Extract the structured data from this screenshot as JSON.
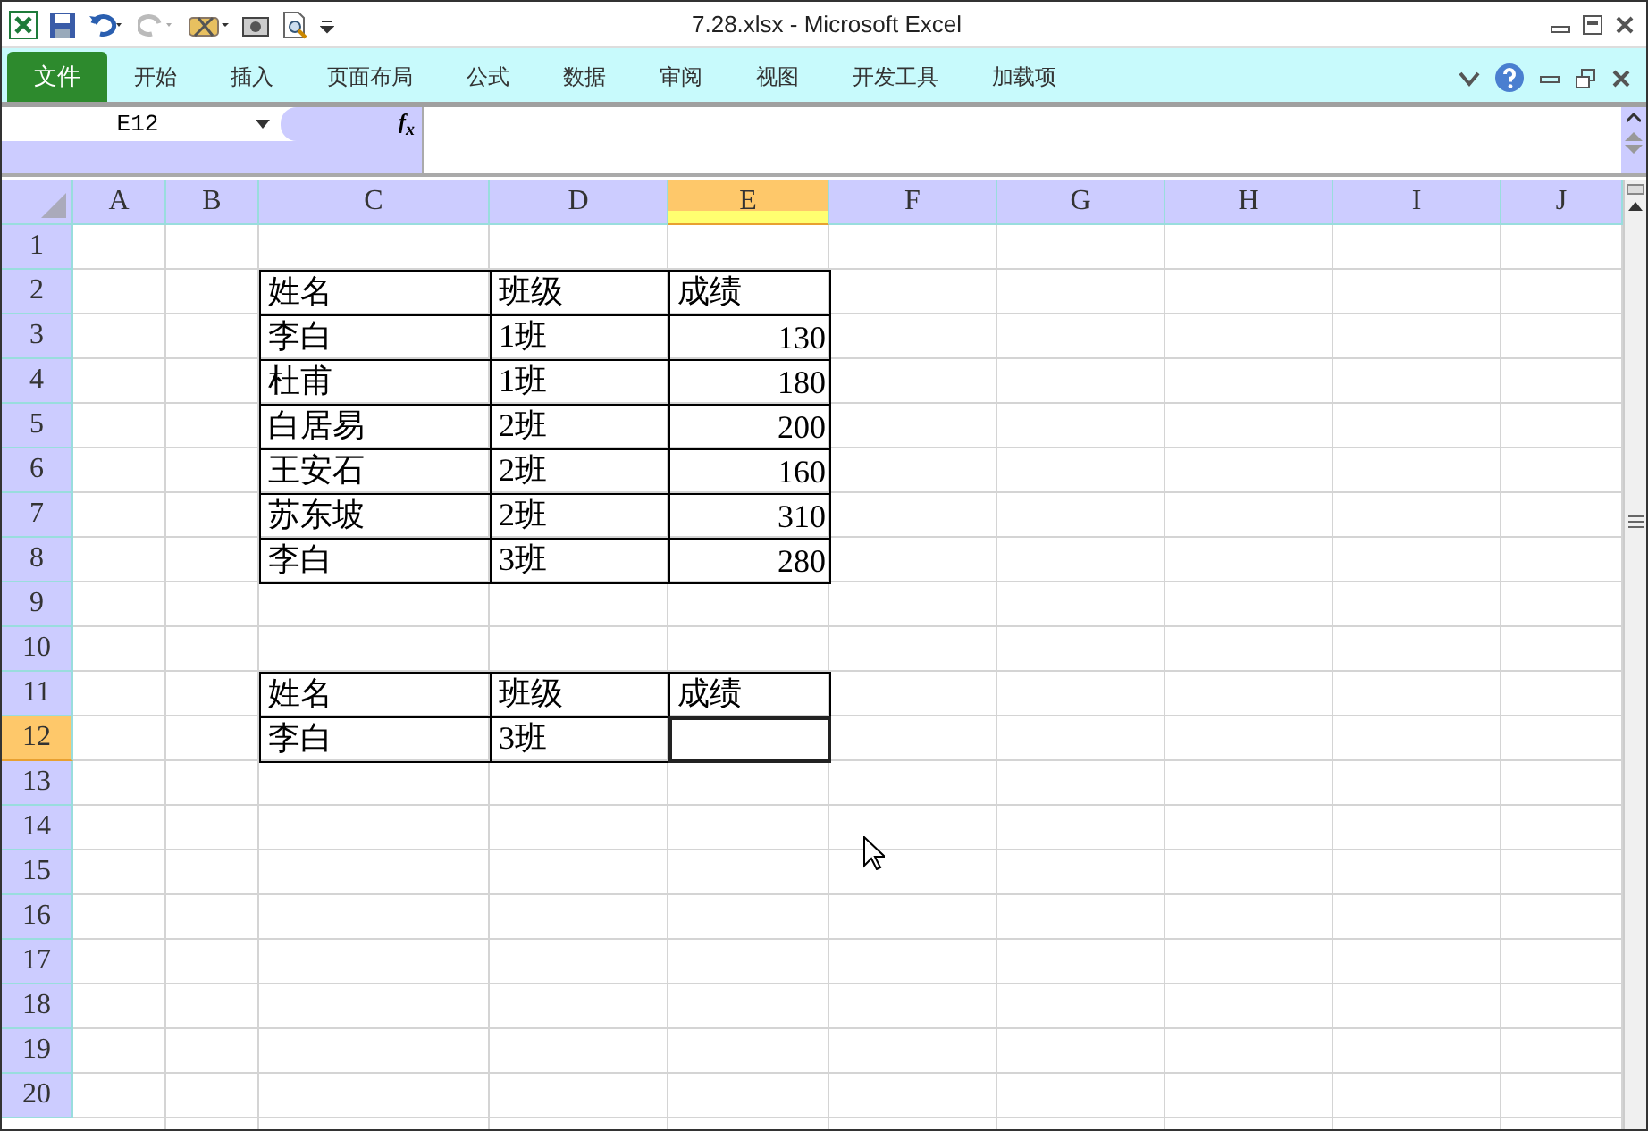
{
  "window": {
    "title": "7.28.xlsx - Microsoft Excel"
  },
  "ribbon": {
    "tabs": [
      {
        "label": "文件",
        "kind": "file",
        "selected": false
      },
      {
        "label": "开始",
        "kind": "tab",
        "selected": false
      },
      {
        "label": "插入",
        "kind": "tab",
        "selected": false
      },
      {
        "label": "页面布局",
        "kind": "tab",
        "selected": false
      },
      {
        "label": "公式",
        "kind": "tab",
        "selected": false
      },
      {
        "label": "数据",
        "kind": "tab",
        "selected": false
      },
      {
        "label": "审阅",
        "kind": "tab",
        "selected": false
      },
      {
        "label": "视图",
        "kind": "tab",
        "selected": false
      },
      {
        "label": "开发工具",
        "kind": "tab",
        "selected": false
      },
      {
        "label": "加载项",
        "kind": "tab",
        "selected": false
      }
    ]
  },
  "formula_bar": {
    "name_box": "E12",
    "fx": "f$_{x}$"
  },
  "sheet": {
    "columns": [
      {
        "label": "A",
        "selected": false
      },
      {
        "label": "B",
        "selected": false
      },
      {
        "label": "C",
        "selected": false
      },
      {
        "label": "D",
        "selected": false
      },
      {
        "label": "E",
        "selected": true
      },
      {
        "label": "F",
        "selected": false
      },
      {
        "label": "G",
        "selected": false
      },
      {
        "label": "H",
        "selected": false
      },
      {
        "label": "I",
        "selected": false
      },
      {
        "label": "J",
        "selected": false
      }
    ],
    "rows": [
      {
        "header": "1",
        "selected": false,
        "bordered": false
      },
      {
        "header": "2",
        "selected": false,
        "bordered": true,
        "cells": {
          "C": "姓名",
          "D": "班级",
          "E": "成绩"
        }
      },
      {
        "header": "3",
        "selected": false,
        "bordered": true,
        "cells": {
          "C": "李白",
          "D": "1班",
          "E": "130"
        }
      },
      {
        "header": "4",
        "selected": false,
        "bordered": true,
        "cells": {
          "C": "杜甫",
          "D": "1班",
          "E": "180"
        }
      },
      {
        "header": "5",
        "selected": false,
        "bordered": true,
        "cells": {
          "C": "白居易",
          "D": "2班",
          "E": "200"
        }
      },
      {
        "header": "6",
        "selected": false,
        "bordered": true,
        "cells": {
          "C": "王安石",
          "D": "2班",
          "E": "160"
        }
      },
      {
        "header": "7",
        "selected": false,
        "bordered": true,
        "cells": {
          "C": "苏东坡",
          "D": "2班",
          "E": "310"
        }
      },
      {
        "header": "8",
        "selected": false,
        "bordered": true,
        "cells": {
          "C": "李白",
          "D": "3班",
          "E": "280"
        }
      },
      {
        "header": "9",
        "selected": false,
        "bordered": false
      },
      {
        "header": "10",
        "selected": false,
        "bordered": false
      },
      {
        "header": "11",
        "selected": false,
        "bordered": true,
        "cells": {
          "C": "姓名",
          "D": "班级",
          "E": "成绩"
        }
      },
      {
        "header": "12",
        "selected": true,
        "bordered": true,
        "cells": {
          "C": "李白",
          "D": "3班"
        }
      },
      {
        "header": "13",
        "selected": false,
        "bordered": false
      },
      {
        "header": "14",
        "selected": false,
        "bordered": false
      },
      {
        "header": "15",
        "selected": false,
        "bordered": false
      },
      {
        "header": "16",
        "selected": false,
        "bordered": false
      },
      {
        "header": "17",
        "selected": false,
        "bordered": false
      },
      {
        "header": "18",
        "selected": false,
        "bordered": false
      },
      {
        "header": "19",
        "selected": false,
        "bordered": false
      },
      {
        "header": "20",
        "selected": false,
        "bordered": false
      }
    ]
  }
}
